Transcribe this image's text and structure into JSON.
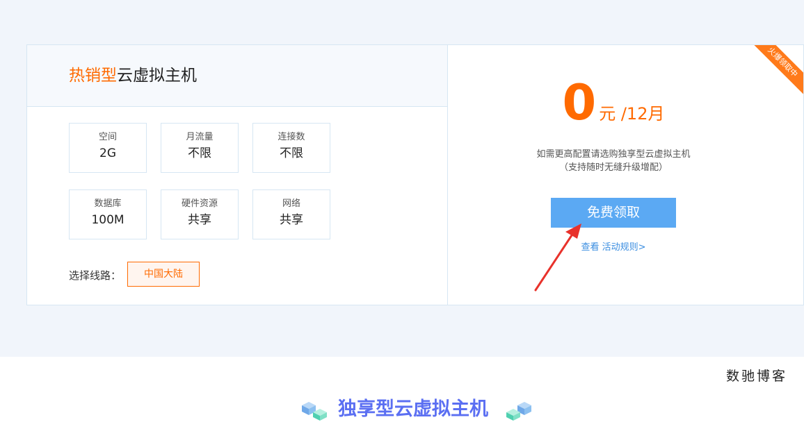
{
  "plan": {
    "title_hot": "热销型",
    "title_rest": "云虚拟主机",
    "specs": [
      {
        "label": "空间",
        "value": "2G"
      },
      {
        "label": "月流量",
        "value": "不限"
      },
      {
        "label": "连接数",
        "value": "不限"
      },
      {
        "label": "数据库",
        "value": "100M"
      },
      {
        "label": "硬件资源",
        "value": "共享"
      },
      {
        "label": "网络",
        "value": "共享"
      }
    ],
    "route_label": "选择线路：",
    "route_option": "中国大陆"
  },
  "offer": {
    "price": "0",
    "price_unit": "元 /12月",
    "note_line1": "如需更高配置请选购独享型云虚拟主机",
    "note_line2": "（支持随时无缝升级增配）",
    "claim_label": "免费领取",
    "rules_link": "查看 活动规则>",
    "ribbon": "火爆领取中"
  },
  "footer": {
    "brand": "数驰博客",
    "section_title": "独享型云虚拟主机"
  },
  "colors": {
    "accent": "#ff6a00",
    "button": "#5ba9f3",
    "arrow": "#e8322b",
    "section_title": "#5b6ff2"
  }
}
